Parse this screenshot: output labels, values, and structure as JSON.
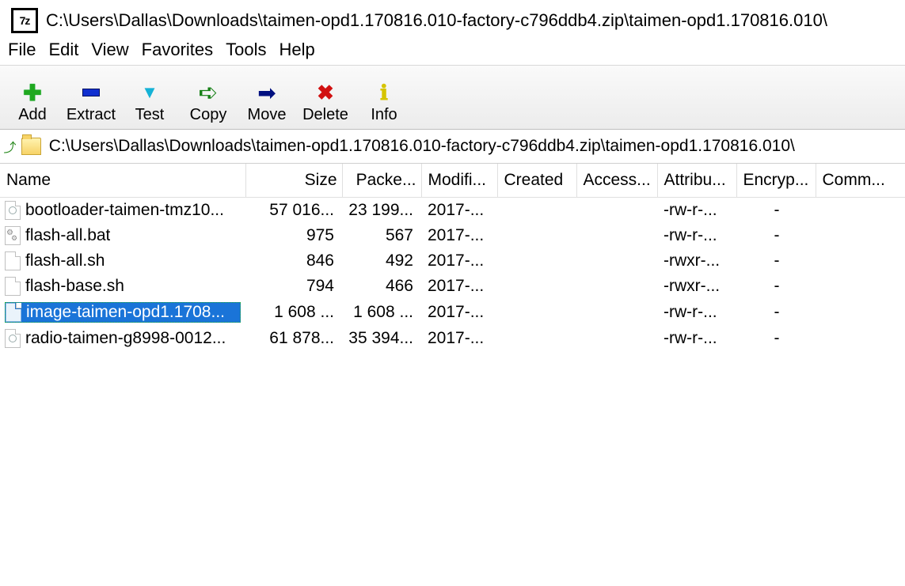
{
  "title_path": "C:\\Users\\Dallas\\Downloads\\taimen-opd1.170816.010-factory-c796ddb4.zip\\taimen-opd1.170816.010\\",
  "menu": [
    "File",
    "Edit",
    "View",
    "Favorites",
    "Tools",
    "Help"
  ],
  "toolbar": {
    "add": "Add",
    "extract": "Extract",
    "test": "Test",
    "copy": "Copy",
    "move": "Move",
    "delete": "Delete",
    "info": "Info"
  },
  "path_input": "C:\\Users\\Dallas\\Downloads\\taimen-opd1.170816.010-factory-c796ddb4.zip\\taimen-opd1.170816.010\\",
  "columns": {
    "name": "Name",
    "size": "Size",
    "packed": "Packe...",
    "modified": "Modifi...",
    "created": "Created",
    "accessed": "Access...",
    "attributes": "Attribu...",
    "encrypted": "Encryp...",
    "comment": "Comm..."
  },
  "rows": [
    {
      "icon": "img",
      "name": "bootloader-taimen-tmz10...",
      "size": "57 016...",
      "packed": "23 199...",
      "modified": "2017-...",
      "created": "",
      "accessed": "",
      "attr": "-rw-r-...",
      "enc": "-",
      "comm": "",
      "selected": false
    },
    {
      "icon": "bat",
      "name": "flash-all.bat",
      "size": "975",
      "packed": "567",
      "modified": "2017-...",
      "created": "",
      "accessed": "",
      "attr": "-rw-r-...",
      "enc": "-",
      "comm": "",
      "selected": false
    },
    {
      "icon": "txt",
      "name": "flash-all.sh",
      "size": "846",
      "packed": "492",
      "modified": "2017-...",
      "created": "",
      "accessed": "",
      "attr": "-rwxr-...",
      "enc": "-",
      "comm": "",
      "selected": false
    },
    {
      "icon": "txt",
      "name": "flash-base.sh",
      "size": "794",
      "packed": "466",
      "modified": "2017-...",
      "created": "",
      "accessed": "",
      "attr": "-rwxr-...",
      "enc": "-",
      "comm": "",
      "selected": false
    },
    {
      "icon": "zip",
      "name": "image-taimen-opd1.1708...",
      "size": "1 608 ...",
      "packed": "1 608 ...",
      "modified": "2017-...",
      "created": "",
      "accessed": "",
      "attr": "-rw-r-...",
      "enc": "-",
      "comm": "",
      "selected": true
    },
    {
      "icon": "img",
      "name": "radio-taimen-g8998-0012...",
      "size": "61 878...",
      "packed": "35 394...",
      "modified": "2017-...",
      "created": "",
      "accessed": "",
      "attr": "-rw-r-...",
      "enc": "-",
      "comm": "",
      "selected": false
    }
  ]
}
